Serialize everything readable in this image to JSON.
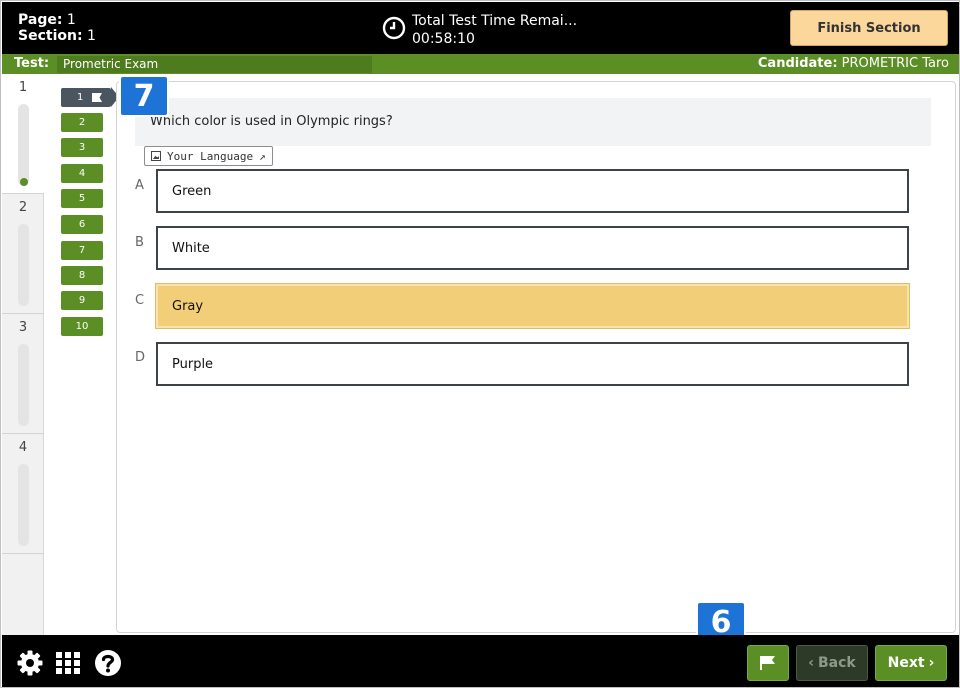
{
  "header": {
    "page_label": "Page:",
    "page_value": "1",
    "section_label": "Section:",
    "section_value": "1",
    "timer_title": "Total Test Time Remai...",
    "timer_value": "00:58:10",
    "finish_label": "Finish Section"
  },
  "testbar": {
    "test_label": "Test:",
    "test_name": "Prometric Exam",
    "candidate_label": "Candidate:",
    "candidate_name": "PROMETRIC Taro"
  },
  "sections": [
    "1",
    "2",
    "3",
    "4"
  ],
  "questions": [
    "1",
    "2",
    "3",
    "4",
    "5",
    "6",
    "7",
    "8",
    "9",
    "10"
  ],
  "question": {
    "text": "Which color is used in Olympic rings?",
    "language_button": "Your Language"
  },
  "options": [
    {
      "letter": "A",
      "text": "Green"
    },
    {
      "letter": "B",
      "text": "White"
    },
    {
      "letter": "C",
      "text": "Gray"
    },
    {
      "letter": "D",
      "text": "Purple"
    }
  ],
  "selected_option": "C",
  "callouts": {
    "top": "7",
    "bottom": "6"
  },
  "footer": {
    "back_label": "Back",
    "next_label": "Next",
    "icons": [
      "gear-icon",
      "grid-icon",
      "help-icon",
      "flag-icon"
    ]
  },
  "colors": {
    "accent_green": "#5b8e24",
    "finish_button": "#fbd79c",
    "selected_option": "#f2ce78",
    "callout_blue": "#1e73d6"
  }
}
